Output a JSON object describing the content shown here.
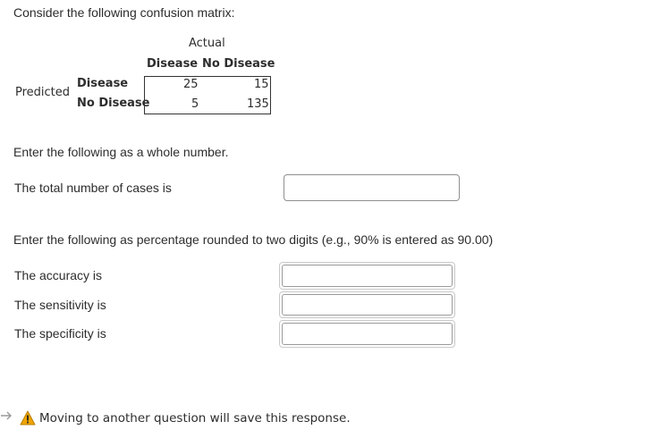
{
  "intro": "Consider the following confusion matrix:",
  "matrix": {
    "actual_label": "Actual",
    "predicted_label": "Predicted",
    "col_headers": [
      "Disease",
      "No Disease"
    ],
    "row_headers": [
      "Disease",
      "No Disease"
    ],
    "cells": [
      [
        "25",
        "15"
      ],
      [
        "5",
        "135"
      ]
    ]
  },
  "section1": {
    "instruction": "Enter the following as a whole number.",
    "question": "The total number of cases is",
    "value": ""
  },
  "section2": {
    "instruction": "Enter the following as percentage rounded to two digits (e.g., 90% is entered as 90.00)",
    "questions": [
      {
        "label": "The accuracy is",
        "value": ""
      },
      {
        "label": "The sensitivity is",
        "value": ""
      },
      {
        "label": "The specificity is",
        "value": ""
      }
    ]
  },
  "footer": {
    "message": "Moving to another question will save this response.",
    "warning_color": "#f0a500"
  }
}
